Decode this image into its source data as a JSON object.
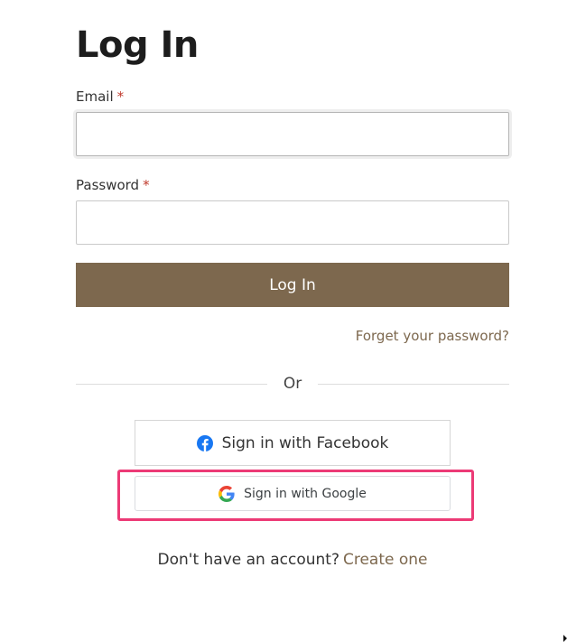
{
  "page": {
    "title": "Log In"
  },
  "form": {
    "email_label": "Email",
    "password_label": "Password",
    "required_marker": "*",
    "email_value": "",
    "password_value": "",
    "submit_label": "Log In",
    "forgot_link": "Forget your password?"
  },
  "divider": {
    "text": "Or"
  },
  "social": {
    "facebook_label": "Sign in with Facebook",
    "facebook_icon": "facebook-icon",
    "google_label": "Sign in with Google",
    "google_icon": "google-icon"
  },
  "signup": {
    "prompt": "Don't have an account?",
    "link": "Create one"
  },
  "colors": {
    "accent": "#7d684e",
    "highlight": "#ec3a76",
    "facebook": "#1877f2"
  }
}
